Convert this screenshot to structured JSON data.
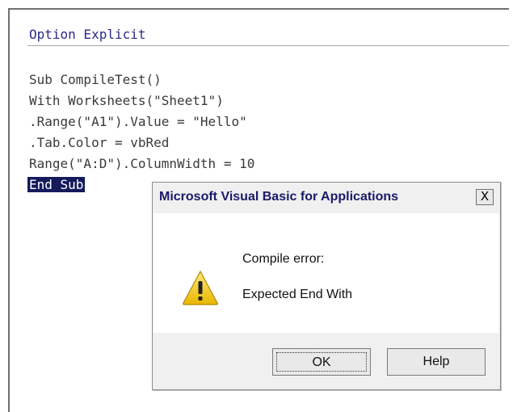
{
  "editor": {
    "declaration": "Option Explicit",
    "lines": [
      "Sub CompileTest()",
      "With Worksheets(\"Sheet1\")",
      ".Range(\"A1\").Value = \"Hello\"",
      ".Tab.Color = vbRed",
      "Range(\"A:D\").ColumnWidth = 10"
    ],
    "selected_line": "End Sub"
  },
  "dialog": {
    "title": "Microsoft Visual Basic for Applications",
    "close_label": "X",
    "message_line1": "Compile error:",
    "message_line2": "Expected End With",
    "ok_label": "OK",
    "help_label": "Help",
    "icon": "warning-icon"
  }
}
